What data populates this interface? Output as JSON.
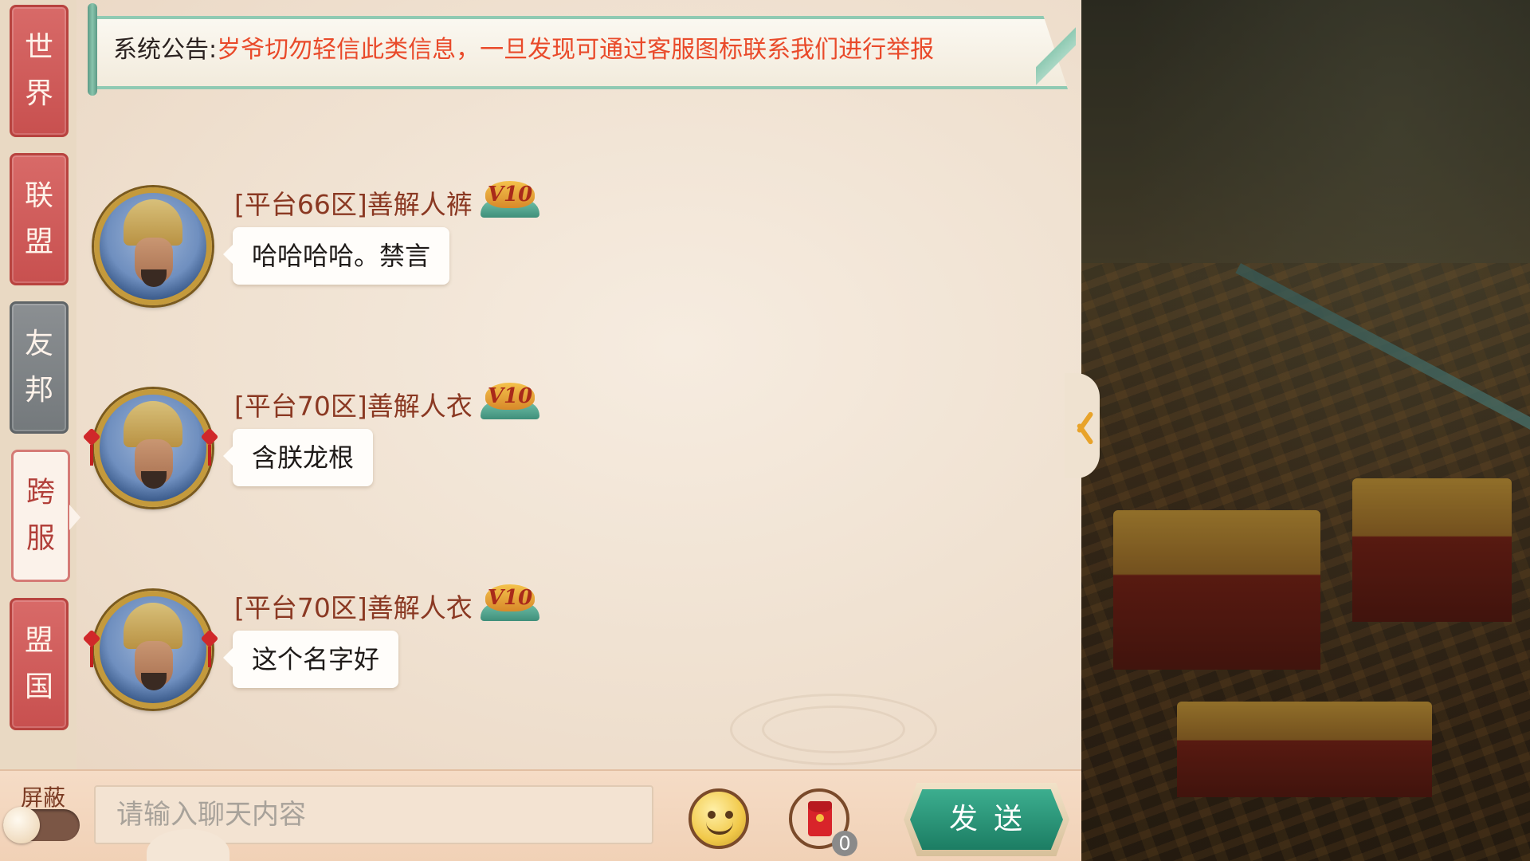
{
  "tabs": [
    {
      "label_top": "世",
      "label_bottom": "界",
      "state": "red"
    },
    {
      "label_top": "联",
      "label_bottom": "盟",
      "state": "red"
    },
    {
      "label_top": "友",
      "label_bottom": "邦",
      "state": "gray"
    },
    {
      "label_top": "跨",
      "label_bottom": "服",
      "state": "active"
    },
    {
      "label_top": "盟",
      "label_bottom": "国",
      "state": "red"
    }
  ],
  "announcement": {
    "label": "系统公告:",
    "message": "岁爷切勿轻信此类信息，一旦发现可通过客服图标联系我们进行举报"
  },
  "messages": [
    {
      "sender": "[平台66区]善解人裤",
      "vip": "V10",
      "text": "哈哈哈哈。禁言",
      "avatar_frame": "gold-ring"
    },
    {
      "sender": "[平台70区]善解人衣",
      "vip": "V10",
      "text": "含朕龙根",
      "avatar_frame": "gold-ring-knots"
    },
    {
      "sender": "[平台70区]善解人衣",
      "vip": "V10",
      "text": "这个名字好",
      "avatar_frame": "gold-ring-knots"
    }
  ],
  "bottom_bar": {
    "shield_label": "屏蔽",
    "input_placeholder": "请输入聊天内容",
    "red_packet_count": "0",
    "send_label": "发送"
  },
  "icons": {
    "emoji": "smiley-icon",
    "red_packet": "red-envelope-icon",
    "expand": "chevron-left-icon"
  },
  "colors": {
    "announcement_text": "#e94a2a",
    "sender_name": "#8a3822",
    "tab_red": "#c8504f",
    "send_button": "#1c7d63"
  }
}
